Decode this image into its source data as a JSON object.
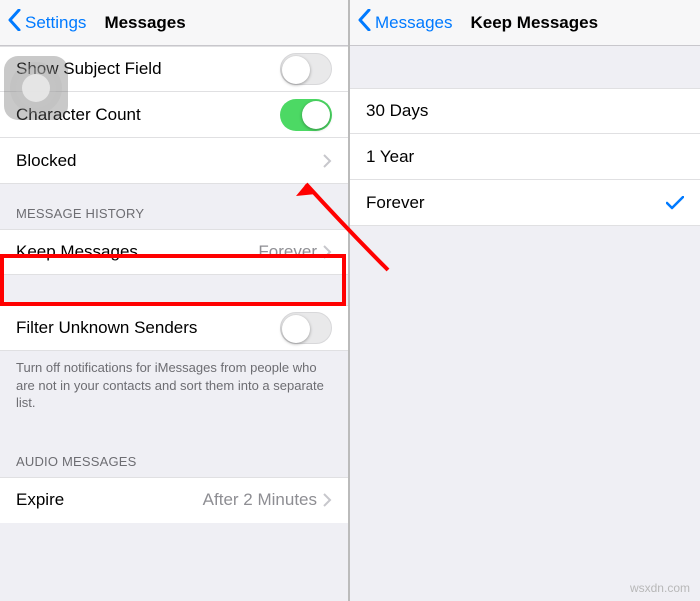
{
  "left": {
    "back_label": "Settings",
    "title": "Messages",
    "rows": {
      "show_subject": "Show Subject Field",
      "char_count": "Character Count",
      "blocked": "Blocked",
      "keep_messages": "Keep Messages",
      "keep_messages_value": "Forever",
      "filter_unknown": "Filter Unknown Senders",
      "expire": "Expire",
      "expire_value": "After 2 Minutes"
    },
    "sections": {
      "message_history": "MESSAGE HISTORY",
      "audio_messages": "AUDIO MESSAGES"
    },
    "footer_filter": "Turn off notifications for iMessages from people who are not in your contacts and sort them into a separate list."
  },
  "right": {
    "back_label": "Messages",
    "title": "Keep Messages",
    "options": {
      "opt0": "30 Days",
      "opt1": "1 Year",
      "opt2": "Forever"
    },
    "selected": "Forever"
  },
  "watermark": "wsxdn.com"
}
